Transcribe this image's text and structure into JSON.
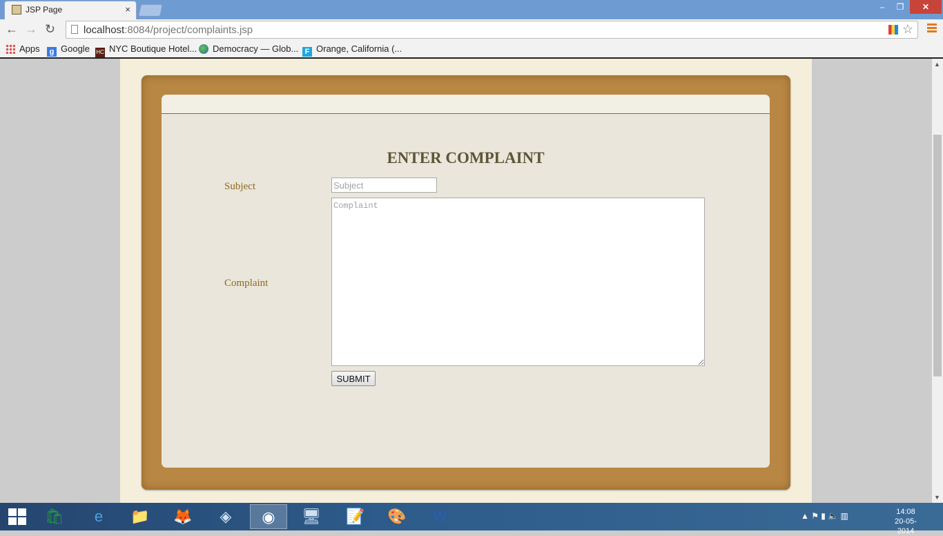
{
  "browser": {
    "tab_title": "JSP Page",
    "tab_close": "×",
    "url_host": "localhost",
    "url_rest": ":8084/project/complaints.jsp",
    "nav": {
      "back": "←",
      "forward": "→",
      "reload": "↻"
    },
    "window_controls": {
      "minimize": "–",
      "maximize": "❐",
      "close": "✕"
    },
    "bookmarks": [
      {
        "label": "Apps",
        "icon": "apps-grid-icon"
      },
      {
        "label": "Google",
        "icon": "google-icon",
        "glyph": "g"
      },
      {
        "label": "NYC Boutique Hotel...",
        "icon": "hc-icon",
        "glyph": "HC"
      },
      {
        "label": "Democracy — Glob...",
        "icon": "globe-icon"
      },
      {
        "label": "Orange, California (...",
        "icon": "f-icon",
        "glyph": "F"
      }
    ]
  },
  "form": {
    "heading": "ENTER COMPLAINT",
    "subject_label": "Subject",
    "subject_placeholder": "Subject",
    "complaint_label": "Complaint",
    "complaint_placeholder": "Complaint",
    "submit_label": "SUBMIT"
  },
  "taskbar": {
    "apps": [
      {
        "icon": "store-icon",
        "glyph": "🛍"
      },
      {
        "icon": "internet-explorer-icon",
        "glyph": "e"
      },
      {
        "icon": "file-explorer-icon",
        "glyph": "📁"
      },
      {
        "icon": "firefox-icon",
        "glyph": "🦊"
      },
      {
        "icon": "virtualbox-icon",
        "glyph": "◈"
      },
      {
        "icon": "chrome-icon",
        "glyph": "◉",
        "active": true
      },
      {
        "icon": "remote-desktop-icon",
        "glyph": "🖥"
      },
      {
        "icon": "editor-icon",
        "glyph": "📝"
      },
      {
        "icon": "paint-icon",
        "glyph": "🎨"
      },
      {
        "icon": "word-icon",
        "glyph": "W"
      }
    ],
    "time": "14:08",
    "date": "20-05-2014"
  },
  "colors": {
    "board": "#b88743",
    "paper": "#ebe6db",
    "heading": "#5b5636",
    "label": "#8a6a1e"
  }
}
